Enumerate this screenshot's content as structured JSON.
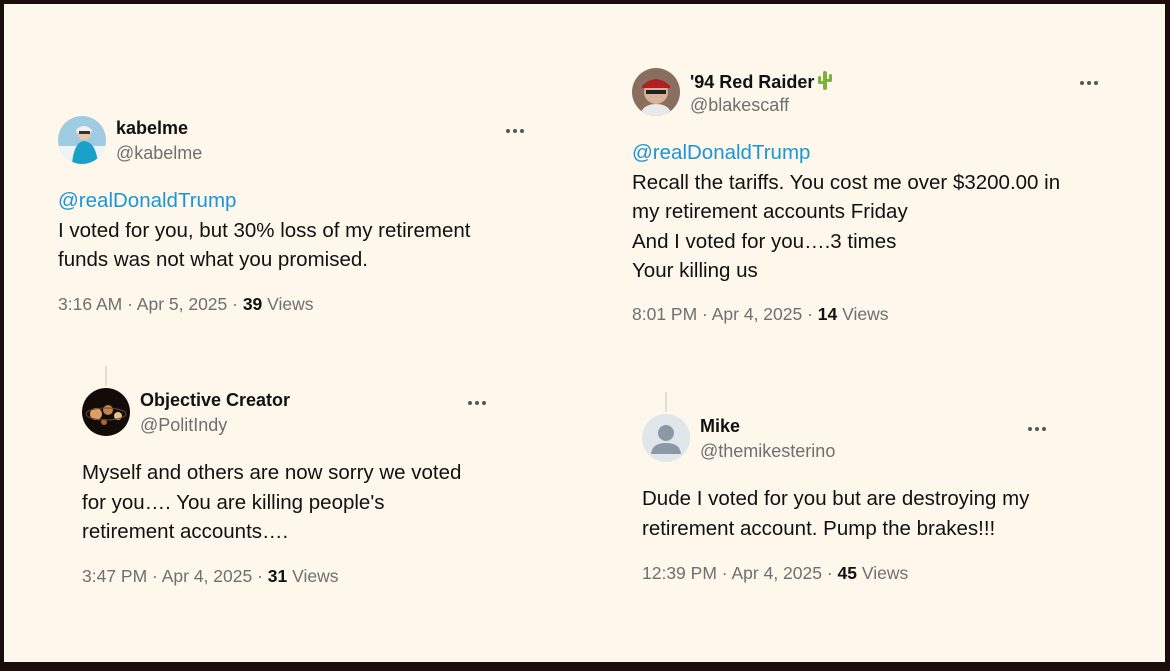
{
  "tweets": [
    {
      "name": "kabelme",
      "handle": "@kabelme",
      "mention": "@realDonaldTrump",
      "lines": [
        "I voted for you, but 30% loss of my retirement",
        "funds was not what you promised."
      ],
      "time": "3:16 AM · Apr 5, 2025 · ",
      "views_count": "39",
      "views_label": " Views",
      "avatar_icon": "skier-avatar"
    },
    {
      "name": "'94 Red Raider",
      "handle": "@blakescaff",
      "mention": "@realDonaldTrump",
      "lines": [
        "Recall the tariffs. You cost me over $3200.00 in",
        "my retirement accounts Friday",
        "And I voted for you….3 times",
        "Your killing us"
      ],
      "time": "8:01 PM · Apr 4, 2025 · ",
      "views_count": "14",
      "views_label": " Views",
      "avatar_icon": "man-with-cap-avatar",
      "name_emoji": "cactus-icon"
    },
    {
      "name": "Objective Creator",
      "handle": "@PolitIndy",
      "lines": [
        "Myself and others are now sorry we voted",
        "for you…. You are killing people's",
        "retirement accounts…."
      ],
      "time": "3:47 PM · Apr 4, 2025 · ",
      "views_count": "31",
      "views_label": " Views",
      "avatar_icon": "solar-system-avatar"
    },
    {
      "name": "Mike",
      "handle": "@themikesterino",
      "lines": [
        "Dude I voted for you but are destroying my",
        "retirement account.  Pump the brakes!!!"
      ],
      "time": "12:39 PM · Apr 4, 2025 · ",
      "views_count": "45",
      "views_label": " Views",
      "avatar_icon": "default-user-avatar"
    }
  ],
  "colors": {
    "background": "#fef7ec",
    "frame": "#1a0d0a",
    "mention": "#1a96d8",
    "muted": "#6f6f6f"
  }
}
